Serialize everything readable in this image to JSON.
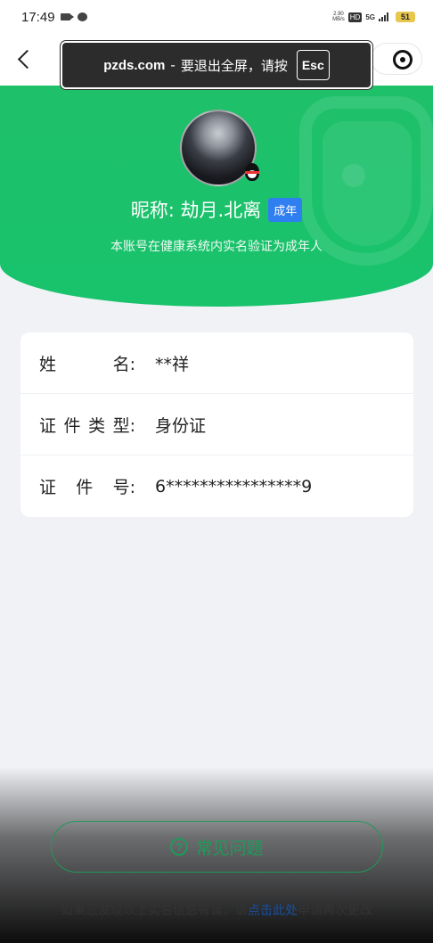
{
  "status_bar": {
    "time": "17:49",
    "speed_top": "2.90",
    "speed_bottom": "MB/s",
    "hd": "HD",
    "network": "5G",
    "battery": "51"
  },
  "fullscreen_banner": {
    "domain": "pzds.com",
    "separator": "-",
    "message": "要退出全屏，请按",
    "key": "Esc"
  },
  "profile": {
    "nickname": "昵称: 劫月.北离",
    "badge": "成年",
    "verify_text": "本账号在健康系统内实名验证为成年人"
  },
  "info": {
    "rows": [
      {
        "label_chars": [
          "姓",
          "名:"
        ],
        "value": "**祥"
      },
      {
        "label_chars": [
          "证",
          "件",
          "类",
          "型:"
        ],
        "value": "身份证"
      },
      {
        "label_chars": [
          "证",
          "件",
          "号:"
        ],
        "value": "6****************9"
      }
    ]
  },
  "faq": {
    "icon_symbol": "?",
    "label": "常见问题"
  },
  "footer": {
    "prefix": "如果您发现以上实名信息有误，请",
    "link": "点击此处",
    "suffix": "申请再次更改"
  },
  "icons": {
    "back": "chevron-left-icon",
    "target": "target-icon",
    "help": "question-circle-icon"
  },
  "colors": {
    "hero_green": "#1fc06a",
    "badge_blue": "#2f7ff0",
    "faq_green": "#1d9b5a"
  }
}
